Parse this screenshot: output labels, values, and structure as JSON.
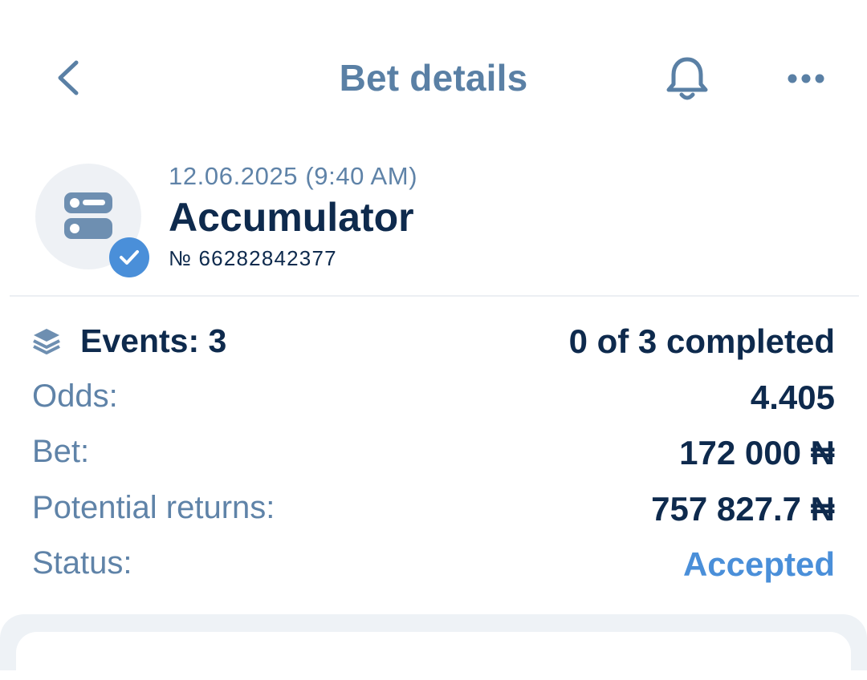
{
  "header": {
    "title": "Bet details",
    "back_icon": "chevron-left-icon",
    "bell_icon": "bell-icon",
    "more_icon": "more-dots-icon"
  },
  "bet": {
    "date": "12.06.2025 (9:40 AM)",
    "type": "Accumulator",
    "number": "№ 66282842377",
    "avatar_icon": "bet-slip-icon",
    "badge_icon": "check-icon"
  },
  "details": {
    "events_label": "Events: 3",
    "events_value": "0 of 3 completed",
    "odds_label": "Odds:",
    "odds_value": "4.405",
    "bet_label": "Bet:",
    "bet_value": "172 000 ₦",
    "returns_label": "Potential returns:",
    "returns_value": "757 827.7 ₦",
    "status_label": "Status:",
    "status_value": "Accepted"
  },
  "colors": {
    "accent": "#4a8fd9",
    "primary_text": "#0e2a4d",
    "secondary_text": "#5f83a8",
    "title": "#5a80a5"
  }
}
